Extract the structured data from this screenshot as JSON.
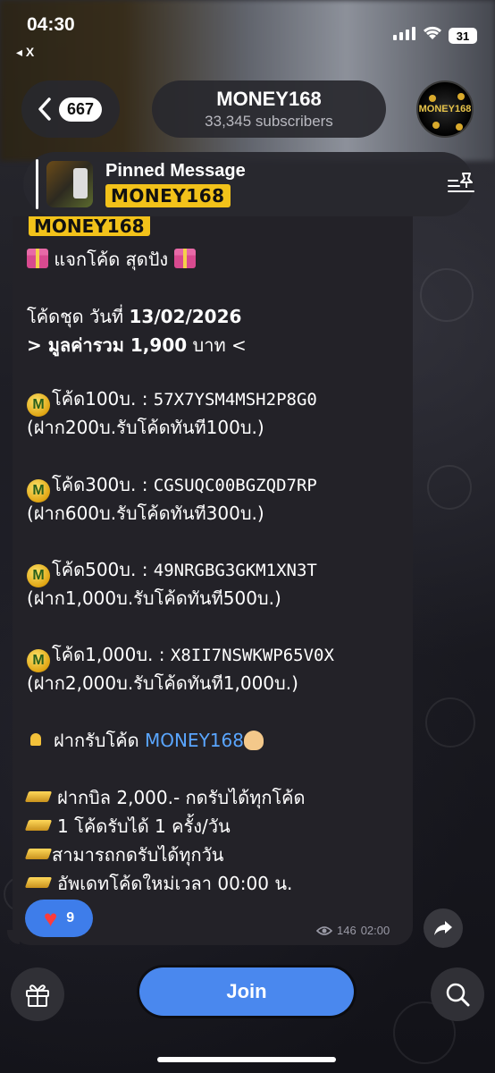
{
  "status_bar": {
    "time": "04:30",
    "back_app": "◂ X",
    "battery": "31"
  },
  "header": {
    "back_count": "667",
    "channel_name": "MONEY168",
    "subscribers": "33,345 subscribers",
    "avatar_text": "MONEY168"
  },
  "pinned": {
    "title": "Pinned Message",
    "preview": "MONEY168"
  },
  "message": {
    "logo": "MONEY168",
    "headline": "แจกโค้ด สุดปัง",
    "date_line_prefix": "โค้ดชุด วันที่ ",
    "date": "13/02/2026",
    "total_prefix": "> มูลค่ารวม ",
    "total_value": "1,900",
    "total_suffix": " บาท  <",
    "codes": [
      {
        "label": "โค้ด100บ. : ",
        "code": "57X7YSM4MSH2P8G0",
        "condition": "(ฝาก200บ.รับโค้ดทันที100บ.)"
      },
      {
        "label": "โค้ด300บ. : ",
        "code": "CGSUQC00BGZQD7RP",
        "condition": "(ฝาก600บ.รับโค้ดทันที300บ.)"
      },
      {
        "label": "โค้ด500บ. : ",
        "code": "49NRGBG3GKM1XN3T",
        "condition": "(ฝาก1,000บ.รับโค้ดทันที500บ.)"
      },
      {
        "label": "โค้ด1,000บ. : ",
        "code": "X8II7NSWKWP65V0X",
        "condition": "(ฝาก2,000บ.รับโค้ดทันที1,000บ.)"
      }
    ],
    "deposit_prefix": "ฝากรับโค้ด ",
    "deposit_link": "MONEY168",
    "rules": [
      "ฝากบิล 2,000.- กดรับได้ทุกโค้ด",
      "1 โค้ดรับได้ 1 ครั้ง/วัน",
      "สามารถกดรับได้ทุกวัน",
      "อัพเดทโค้ดใหม่เวลา 00:00 น."
    ],
    "reaction_count": "9",
    "views": "146",
    "time": "02:00"
  },
  "bottom": {
    "join_label": "Join"
  },
  "colors": {
    "accent": "#4a88ee",
    "link": "#5aa6ff",
    "logo_yellow": "#f2c21a"
  },
  "icons": [
    "back-chevron-icon",
    "unpin-icon",
    "gift-icon",
    "m-coin-icon",
    "bell-icon",
    "clap-hand-icon",
    "gold-bar-icon",
    "heart-icon",
    "eye-icon",
    "forward-icon",
    "search-icon"
  ]
}
